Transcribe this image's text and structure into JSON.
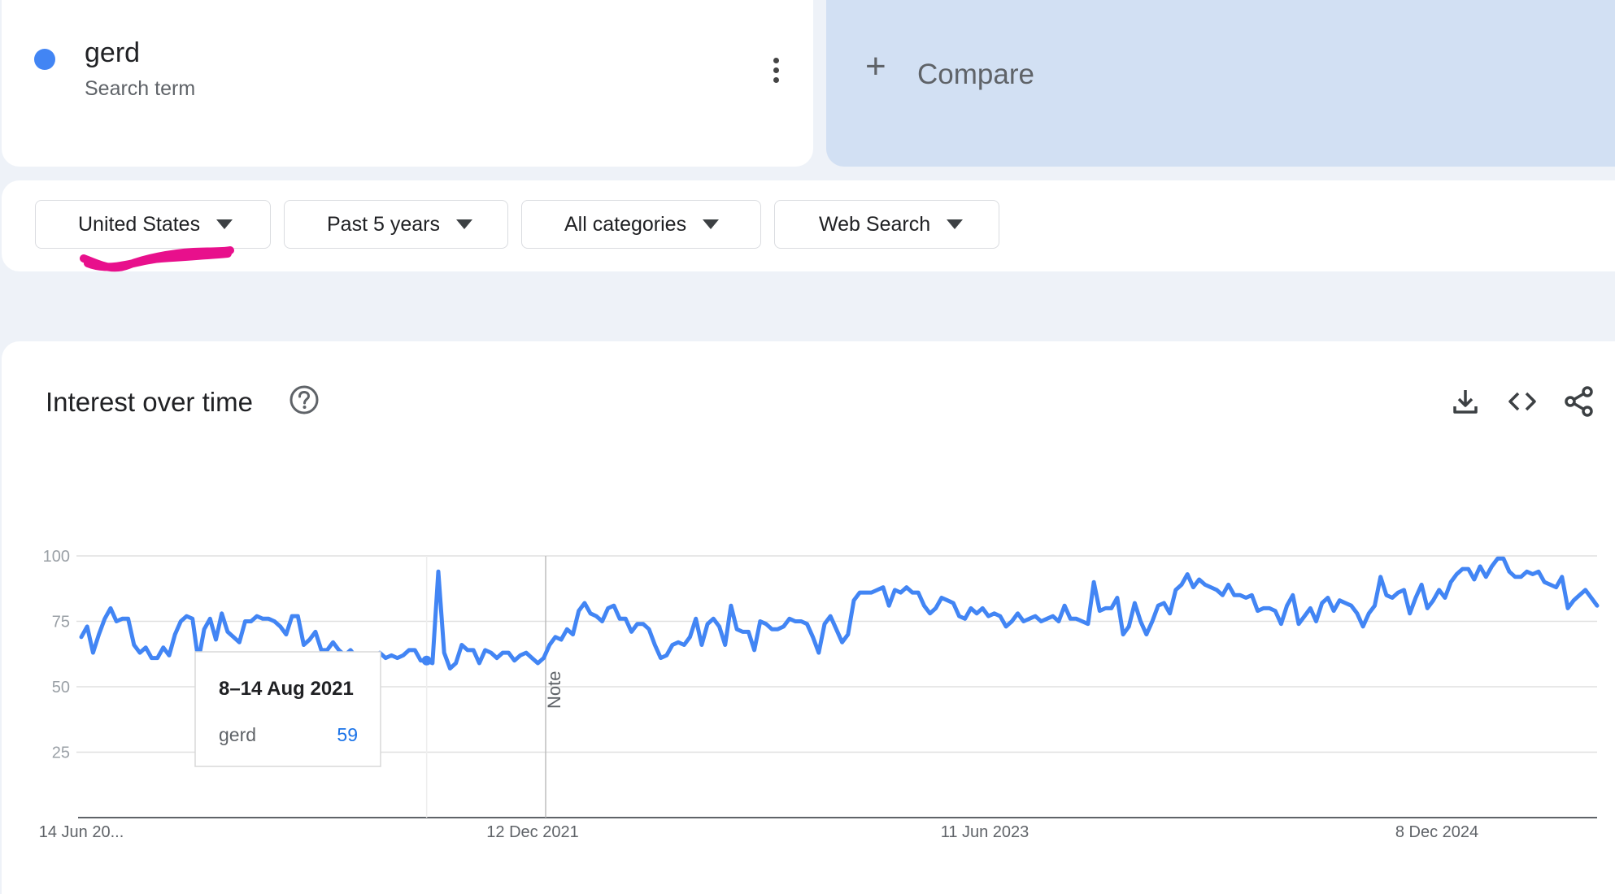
{
  "search_term": {
    "name": "gerd",
    "type": "Search term",
    "color": "#4285f4"
  },
  "compare": {
    "label": "Compare",
    "icon": "plus-icon"
  },
  "filters": {
    "region": "United States",
    "period": "Past 5 years",
    "category": "All categories",
    "property": "Web Search"
  },
  "highlight_color": "#e8108c",
  "panel": {
    "title": "Interest over time",
    "icons": [
      "help-icon",
      "download-icon",
      "embed-code-icon",
      "share-icon"
    ]
  },
  "tooltip": {
    "date": "8–14 Aug 2021",
    "term": "gerd",
    "value": "59"
  },
  "note_label": "Note",
  "chart_data": {
    "type": "line",
    "x_tick_labels": [
      "14 Jun 20...",
      "12 Dec 2021",
      "11 Jun 2023",
      "8 Dec 2024"
    ],
    "y_ticks": [
      25,
      50,
      75,
      100
    ],
    "ylim": [
      0,
      100
    ],
    "grid": true,
    "series": [
      {
        "name": "gerd",
        "color": "#4285f4",
        "values": [
          69,
          73,
          63,
          70,
          76,
          80,
          75,
          76,
          76,
          66,
          63,
          65,
          61,
          61,
          65,
          62,
          70,
          75,
          77,
          76,
          60,
          72,
          76,
          68,
          78,
          71,
          69,
          67,
          75,
          75,
          77,
          76,
          76,
          75,
          73,
          70,
          77,
          77,
          66,
          68,
          71,
          64,
          64,
          67,
          64,
          62,
          64,
          61,
          60,
          62,
          59,
          63,
          61,
          62,
          61,
          62,
          64,
          64,
          60,
          60,
          59,
          94,
          63,
          57,
          59,
          66,
          64,
          64,
          59,
          64,
          63,
          61,
          63,
          63,
          60,
          62,
          63,
          61,
          59,
          61,
          66,
          69,
          68,
          72,
          70,
          79,
          82,
          78,
          77,
          75,
          80,
          81,
          76,
          76,
          71,
          74,
          74,
          72,
          66,
          61,
          62,
          66,
          67,
          66,
          69,
          76,
          66,
          74,
          76,
          73,
          66,
          81,
          72,
          71,
          71,
          64,
          75,
          74,
          72,
          72,
          73,
          76,
          75,
          75,
          74,
          69,
          63,
          74,
          77,
          72,
          67,
          70,
          83,
          86,
          86,
          86,
          87,
          88,
          81,
          87,
          86,
          88,
          86,
          86,
          81,
          78,
          80,
          84,
          83,
          82,
          77,
          76,
          80,
          78,
          80,
          77,
          78,
          77,
          73,
          75,
          78,
          75,
          76,
          77,
          75,
          76,
          77,
          75,
          81,
          76,
          76,
          75,
          74,
          90,
          79,
          80,
          80,
          84,
          70,
          73,
          82,
          75,
          70,
          75,
          81,
          82,
          78,
          87,
          89,
          93,
          88,
          91,
          89,
          88,
          87,
          85,
          89,
          85,
          85,
          84,
          85,
          79,
          80,
          80,
          79,
          74,
          81,
          85,
          74,
          77,
          80,
          75,
          82,
          84,
          79,
          83,
          82,
          81,
          78,
          73,
          78,
          81,
          92,
          85,
          84,
          86,
          87,
          78,
          84,
          89,
          80,
          83,
          87,
          84,
          90,
          93,
          95,
          95,
          91,
          96,
          92,
          96,
          99,
          99,
          94,
          92,
          92,
          94,
          93,
          94,
          90,
          89,
          88,
          92,
          80,
          83,
          85,
          87,
          84,
          81
        ]
      }
    ]
  }
}
